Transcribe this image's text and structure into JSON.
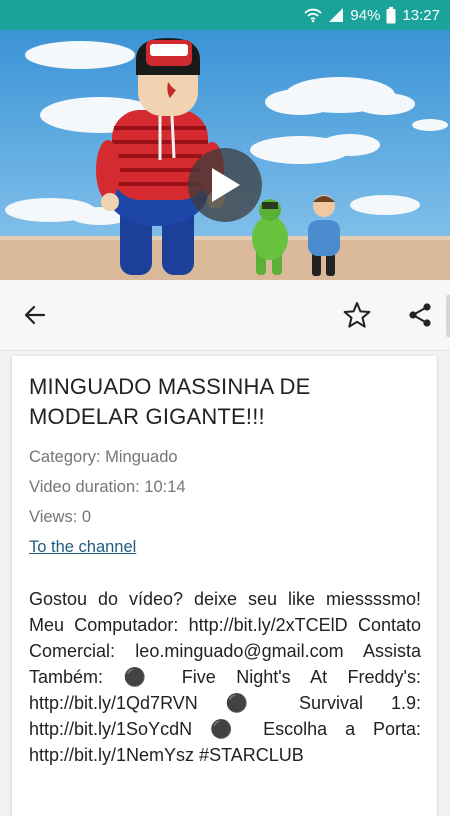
{
  "status_bar": {
    "battery": "94%",
    "time": "13:27",
    "icons": [
      "wifi-icon",
      "signal-icon",
      "battery-icon"
    ]
  },
  "video": {
    "play_icon": "play-icon"
  },
  "toolbar": {
    "back_icon": "arrow-left-icon",
    "favorite_icon": "star-outline-icon",
    "share_icon": "share-icon"
  },
  "details": {
    "title": "MINGUADO MASSINHA DE MODELAR GIGANTE!!!",
    "category": "Category: Minguado",
    "duration": "Video duration: 10:14",
    "views": "Views: 0",
    "channel_link": "To the channel",
    "description": "Gostou do vídeo? deixe seu like miessssmo! Meu Computador: http://bit.ly/2xTCElD Contato Comercial: leo.minguado@gmail.com Assista Também: ⚫ Five Night's At Freddy's: http://bit.ly/1Qd7RVN ⚫ Survival 1.9: http://bit.ly/1SoYcdN ⚫ Escolha a Porta: http://bit.ly/1NemYsz #STARCLUB"
  },
  "colors": {
    "status_bar": "#1aa39a",
    "link": "#1f5c82",
    "meta_text": "#757575"
  }
}
